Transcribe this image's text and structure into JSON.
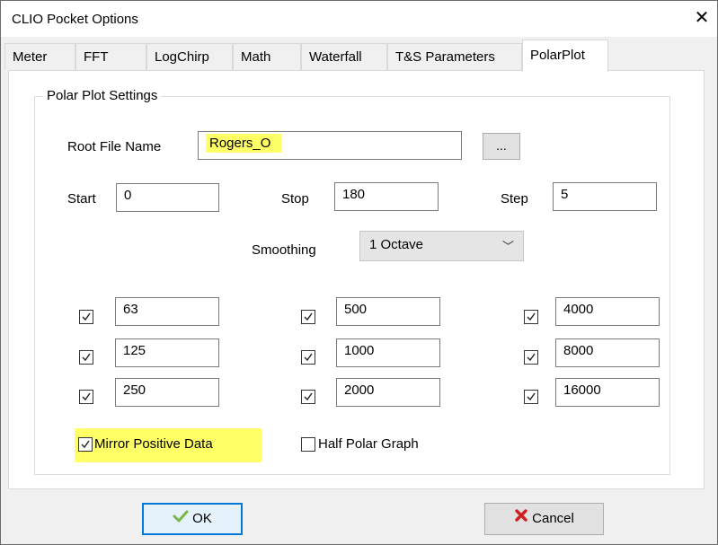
{
  "window": {
    "title": "CLIO Pocket Options",
    "close_glyph": "✕"
  },
  "tabs": [
    {
      "label": "Meter",
      "active": false
    },
    {
      "label": "FFT",
      "active": false
    },
    {
      "label": "LogChirp",
      "active": false
    },
    {
      "label": "Math",
      "active": false
    },
    {
      "label": "Waterfall",
      "active": false
    },
    {
      "label": "T&S Parameters",
      "active": false
    },
    {
      "label": "PolarPlot",
      "active": true
    }
  ],
  "group": {
    "caption": "Polar Plot Settings"
  },
  "root_file": {
    "label": "Root File Name",
    "value": "Rogers_O",
    "browse_label": "..."
  },
  "range": {
    "start_label": "Start",
    "start_value": "0",
    "stop_label": "Stop",
    "stop_value": "180",
    "step_label": "Step",
    "step_value": "5"
  },
  "smoothing": {
    "label": "Smoothing",
    "value": "1 Octave",
    "chevron": "﹀"
  },
  "frequencies": [
    {
      "value": "63",
      "checked": true
    },
    {
      "value": "125",
      "checked": true
    },
    {
      "value": "250",
      "checked": true
    },
    {
      "value": "500",
      "checked": true
    },
    {
      "value": "1000",
      "checked": true
    },
    {
      "value": "2000",
      "checked": true
    },
    {
      "value": "4000",
      "checked": true
    },
    {
      "value": "8000",
      "checked": true
    },
    {
      "value": "16000",
      "checked": true
    }
  ],
  "options": {
    "mirror_label": "Mirror Positive Data",
    "mirror_checked": true,
    "half_label": "Half Polar Graph",
    "half_checked": false
  },
  "buttons": {
    "ok_label": "OK",
    "cancel_label": "Cancel"
  },
  "colors": {
    "highlight": "#ffff66",
    "ok_icon": "#7ab648",
    "cancel_icon": "#d01f1f",
    "default_button_border": "#0078d7"
  },
  "icons": {
    "ok": "checkmark-icon",
    "cancel": "x-mark-icon",
    "checkbox": "checkbox-check-icon"
  }
}
